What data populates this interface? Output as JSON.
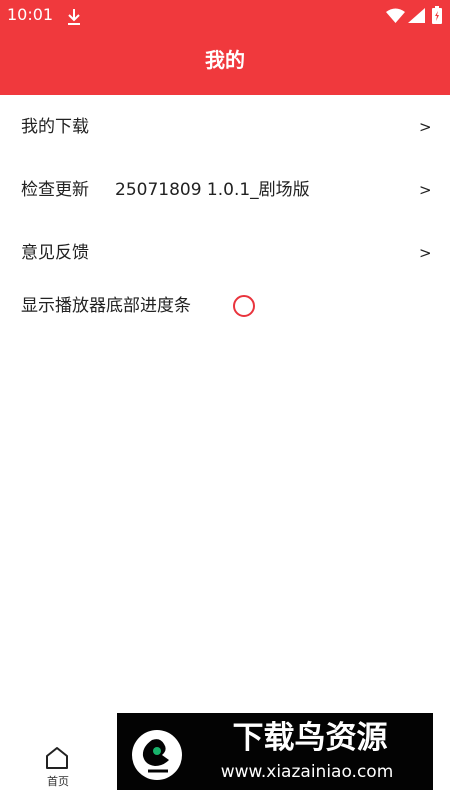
{
  "status": {
    "time": "10:01",
    "icons": [
      "download-icon",
      "wifi-icon",
      "signal-icon",
      "battery-icon"
    ]
  },
  "header": {
    "title": "我的",
    "background_color": "#f0393d"
  },
  "menu": {
    "items": [
      {
        "label": "我的下载",
        "chevron": ">"
      },
      {
        "label": "检查更新",
        "value": "25071809 1.0.1_剧场版",
        "chevron": ">"
      },
      {
        "label": "意见反馈",
        "chevron": ">"
      }
    ],
    "progress_toggle": {
      "label": "显示播放器底部进度条",
      "checked": false,
      "accent_color": "#e9343d"
    }
  },
  "bottom_nav": {
    "home_label": "首页",
    "home_icon": "home-icon"
  },
  "watermark": {
    "title": "下载鸟资源",
    "url": "www.xiazainiao.com"
  }
}
